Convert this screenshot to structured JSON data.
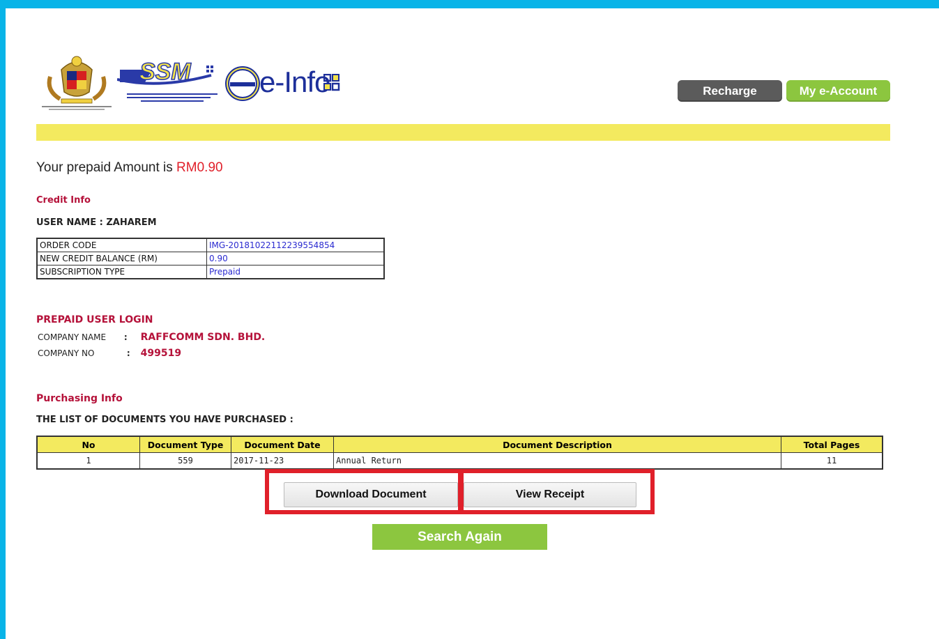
{
  "header": {
    "logo_text": "e-Info",
    "recharge_label": "Recharge",
    "account_label": "My e-Account"
  },
  "prepaid": {
    "label": "Your prepaid Amount is",
    "amount": "RM0.90"
  },
  "credit_info": {
    "title": "Credit Info",
    "user_line": "USER NAME : ZAHAREM",
    "rows": [
      {
        "key": "ORDER CODE",
        "value": "IMG-20181022112239554854"
      },
      {
        "key": "NEW CREDIT BALANCE (RM)",
        "value": "0.90"
      },
      {
        "key": "SUBSCRIPTION TYPE",
        "value": "Prepaid"
      }
    ]
  },
  "prepaid_login": {
    "title": "PREPAID USER LOGIN",
    "company_name_label": "COMPANY NAME",
    "company_name_sep": ":",
    "company_name": "RAFFCOMM SDN. BHD.",
    "company_no_label": "COMPANY NO",
    "company_no_sep": ":",
    "company_no": "499519"
  },
  "purchasing": {
    "title": "Purchasing Info",
    "subtitle": "THE LIST OF DOCUMENTS YOU HAVE PURCHASED :",
    "columns": [
      "No",
      "Document Type",
      "Document Date",
      "Document Description",
      "Total Pages"
    ],
    "rows": [
      {
        "no": "1",
        "type": "559",
        "date": "2017-11-23",
        "description": "Annual Return",
        "pages": "11"
      }
    ]
  },
  "actions": {
    "download_label": "Download Document",
    "receipt_label": "View Receipt",
    "search_label": "Search Again"
  },
  "colors": {
    "page_border": "#08b4e8",
    "accent_yellow": "#f3ea5f",
    "accent_green": "#8cc63f",
    "highlight_red": "#e0202a",
    "label_red": "#b5123a"
  }
}
